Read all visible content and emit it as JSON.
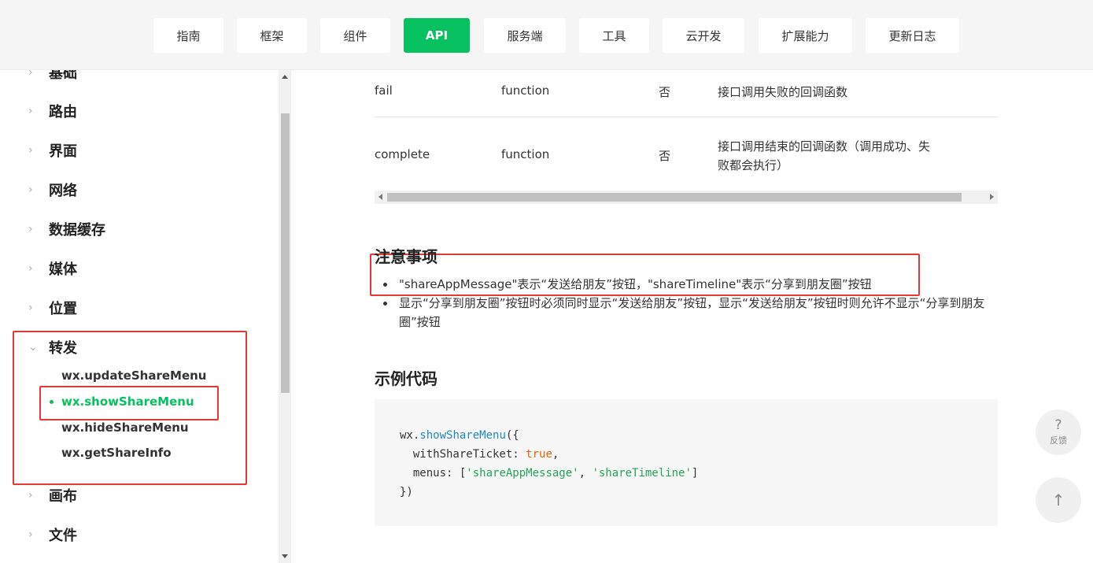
{
  "topnav": {
    "items": [
      {
        "label": "指南"
      },
      {
        "label": "框架"
      },
      {
        "label": "组件"
      },
      {
        "label": "API"
      },
      {
        "label": "服务端"
      },
      {
        "label": "工具"
      },
      {
        "label": "云开发"
      },
      {
        "label": "扩展能力"
      },
      {
        "label": "更新日志"
      }
    ],
    "active": "API"
  },
  "sidebar": {
    "items": [
      {
        "label": "基础"
      },
      {
        "label": "路由"
      },
      {
        "label": "界面"
      },
      {
        "label": "网络"
      },
      {
        "label": "数据缓存"
      },
      {
        "label": "媒体"
      },
      {
        "label": "位置"
      },
      {
        "label": "转发"
      },
      {
        "label": "画布"
      },
      {
        "label": "文件"
      }
    ],
    "sub_items": [
      {
        "label": "wx.updateShareMenu"
      },
      {
        "label": "wx.showShareMenu"
      },
      {
        "label": "wx.hideShareMenu"
      },
      {
        "label": "wx.getShareInfo"
      }
    ],
    "active_sub": "wx.showShareMenu"
  },
  "params_table": {
    "rows": [
      {
        "name": "fail",
        "type": "function",
        "required": "否",
        "desc": "接口调用失败的回调函数"
      },
      {
        "name": "complete",
        "type": "function",
        "required": "否",
        "desc_line1": "接口调用结束的回调函数（调用成功、失",
        "desc_line2": "败都会执行）"
      }
    ]
  },
  "notes": {
    "title": "注意事项",
    "items": [
      {
        "text": "\"shareAppMessage\"表示“发送给朋友”按钮，\"shareTimeline\"表示“分享到朋友圈”按钮"
      },
      {
        "text": "显示“分享到朋友圈”按钮时必须同时显示“发送给朋友”按钮，显示“发送给朋友”按钮时则允许不显示“分享到朋友圈”按钮"
      }
    ]
  },
  "example": {
    "title": "示例代码",
    "code": {
      "obj": "wx.",
      "fn": "showShareMenu",
      "open": "({",
      "key1": "  withShareTicket: ",
      "val1": "true",
      "comma1": ",",
      "key2": "  menus: [",
      "str1": "'shareAppMessage'",
      "sep": ", ",
      "str2": "'shareTimeline'",
      "close_arr": "]",
      "close": "})"
    }
  },
  "floating": {
    "feedback_icon": "?",
    "feedback_label": "反馈",
    "top_icon": "arrow-up-icon"
  },
  "colors": {
    "accent": "#07c160",
    "highlight": "#e53935"
  }
}
